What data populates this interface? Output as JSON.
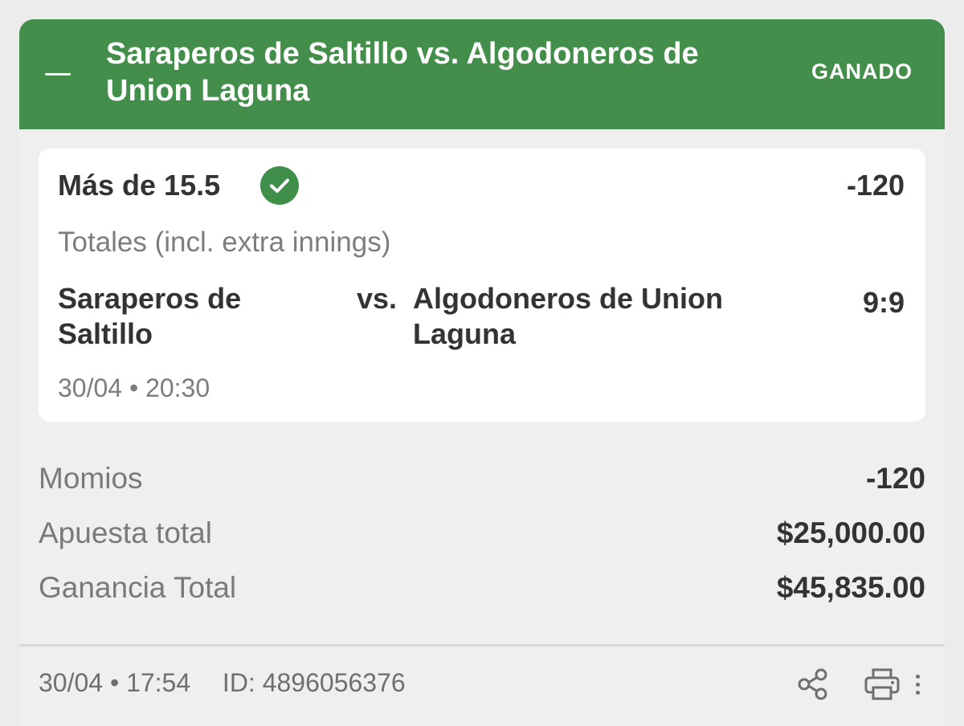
{
  "header": {
    "collapse_icon": "minus-icon",
    "title": "Saraperos de Saltillo vs. Algodoneros de Union Laguna",
    "status": "GANADO",
    "color": "#448e4c"
  },
  "bet": {
    "selection": "Más de 15.5",
    "selection_icon": "check-circle-icon",
    "odds": "-120",
    "market": "Totales (incl. extra innings)",
    "home_team": "Saraperos de Saltillo",
    "vs": "vs.",
    "away_team": "Algodoneros de Union Laguna",
    "score": "9:9",
    "event_time": "30/04 • 20:30"
  },
  "summary": {
    "odds_label": "Momios",
    "odds_value": "-120",
    "stake_label": "Apuesta total",
    "stake_value": "$25,000.00",
    "payout_label": "Ganancia Total",
    "payout_value": "$45,835.00"
  },
  "footer": {
    "placed_time": "30/04 • 17:54",
    "bet_id": "ID: 4896056376",
    "share_icon": "share-icon",
    "print_icon": "print-icon",
    "more_icon": "more-vertical-icon"
  }
}
